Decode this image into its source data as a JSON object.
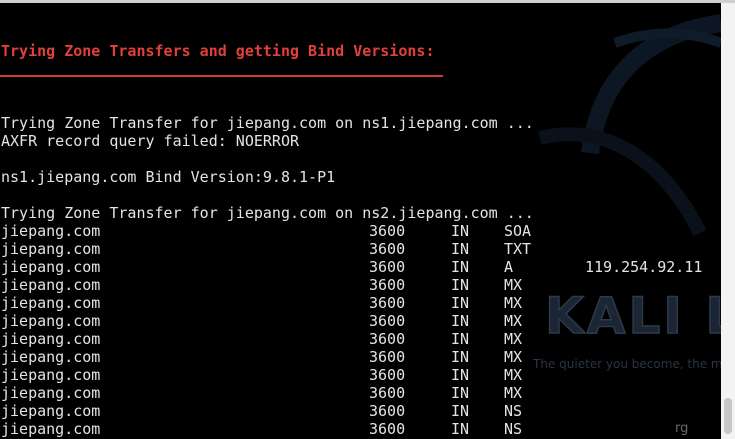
{
  "colors": {
    "heading": "#e0413a",
    "text": "#e4e4e4",
    "background": "#000000"
  },
  "terminal": {
    "heading": "Trying Zone Transfers and getting Bind Versions:",
    "lines": [
      "Trying Zone Transfer for jiepang.com on ns1.jiepang.com ...",
      "AXFR record query failed: NOERROR",
      "ns1.jiepang.com Bind Version:9.8.1-P1",
      "Trying Zone Transfer for jiepang.com on ns2.jiepang.com ..."
    ],
    "records": [
      {
        "host": "jiepang.com",
        "ttl": "3600",
        "class": "IN",
        "type": "SOA",
        "data": ""
      },
      {
        "host": "jiepang.com",
        "ttl": "3600",
        "class": "IN",
        "type": "TXT",
        "data": ""
      },
      {
        "host": "jiepang.com",
        "ttl": "3600",
        "class": "IN",
        "type": "A",
        "data": "119.254.92.11"
      },
      {
        "host": "jiepang.com",
        "ttl": "3600",
        "class": "IN",
        "type": "MX",
        "data": ""
      },
      {
        "host": "jiepang.com",
        "ttl": "3600",
        "class": "IN",
        "type": "MX",
        "data": ""
      },
      {
        "host": "jiepang.com",
        "ttl": "3600",
        "class": "IN",
        "type": "MX",
        "data": ""
      },
      {
        "host": "jiepang.com",
        "ttl": "3600",
        "class": "IN",
        "type": "MX",
        "data": ""
      },
      {
        "host": "jiepang.com",
        "ttl": "3600",
        "class": "IN",
        "type": "MX",
        "data": ""
      },
      {
        "host": "jiepang.com",
        "ttl": "3600",
        "class": "IN",
        "type": "MX",
        "data": ""
      },
      {
        "host": "jiepang.com",
        "ttl": "3600",
        "class": "IN",
        "type": "MX",
        "data": ""
      },
      {
        "host": "jiepang.com",
        "ttl": "3600",
        "class": "IN",
        "type": "NS",
        "data": ""
      },
      {
        "host": "jiepang.com",
        "ttl": "3600",
        "class": "IN",
        "type": "NS",
        "data": ""
      }
    ]
  },
  "wallpaper": {
    "logo_text": "KALI LI",
    "tagline": "The quieter you become, the m"
  },
  "edge_text": "rg"
}
